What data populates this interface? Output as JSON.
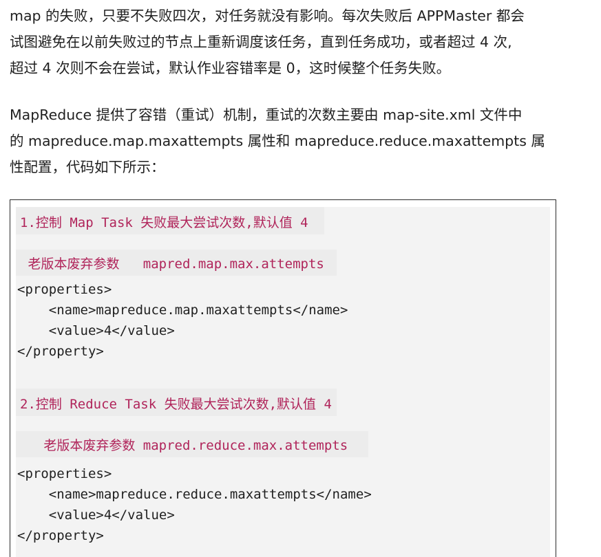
{
  "paragraph1": {
    "lines": [
      "map 的失败，只要不失败四次，对任务就没有影响。每次失败后 APPMaster 都会",
      "试图避免在以前失败过的节点上重新调度该任务，直到任务成功，或者超过 4 次,",
      "超过 4 次则不会在尝试，默认作业容错率是 0，这时候整个任务失败。"
    ]
  },
  "paragraph2": {
    "lines": [
      "MapReduce  提供了容错（重试）机制，重试的次数主要由  map-site.xml 文件中",
      "的  mapreduce.map.maxattempts 属性和 mapreduce.reduce.maxattempts 属",
      "性配置，代码如下所示："
    ]
  },
  "code": {
    "comment1": "1.控制 Map Task 失败最大尝试次数,默认值 4",
    "comment1_old": " 老版本废弃参数   mapred.map.max.attempts",
    "block1": [
      "<properties>",
      "    <name>mapreduce.map.maxattempts</name>",
      "    <value>4</value>",
      "</property>"
    ],
    "comment2": "2.控制 Reduce Task 失败最大尝试次数,默认值 4",
    "comment2_old": "   老版本废弃参数 mapred.reduce.max.attempts",
    "block2": [
      "<properties>",
      "    <name>mapreduce.reduce.maxattempts</name>",
      "    <value>4</value>",
      "</property>"
    ]
  }
}
